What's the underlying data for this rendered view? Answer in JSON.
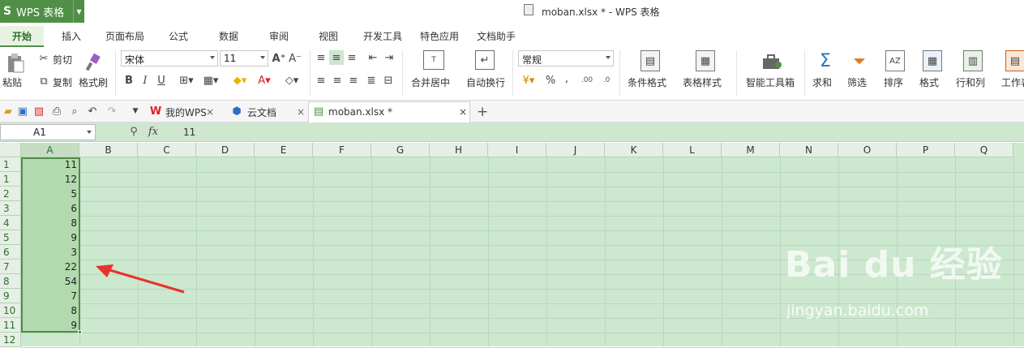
{
  "app": {
    "logo": "S",
    "name": "WPS 表格",
    "title": "moban.xlsx * - WPS 表格"
  },
  "menu": [
    "开始",
    "插入",
    "页面布局",
    "公式",
    "数据",
    "审阅",
    "视图",
    "开发工具",
    "特色应用",
    "文档助手"
  ],
  "ribbon": {
    "paste": "粘贴",
    "cut": "剪切",
    "copy": "复制",
    "format_painter": "格式刷",
    "font_name": "宋体",
    "font_size": "11",
    "merge_center": "合并居中",
    "wrap_text": "自动换行",
    "number_format": "常规",
    "cond_format": "条件格式",
    "table_style": "表格样式",
    "smart_toolbox": "智能工具箱",
    "sum": "求和",
    "filter": "筛选",
    "sort": "排序",
    "format": "格式",
    "rows_cols": "行和列",
    "worksheet": "工作表",
    "percent": "%",
    "comma": ","
  },
  "tabs": {
    "mywps": "我的WPS",
    "cloud": "云文档",
    "file": "moban.xlsx *",
    "close": "×",
    "add": "+"
  },
  "formula": {
    "cell_ref": "A1",
    "fx": "fx",
    "value": "11"
  },
  "columns": [
    "A",
    "B",
    "C",
    "D",
    "E",
    "F",
    "G",
    "H",
    "I",
    "J",
    "K",
    "L",
    "M",
    "N",
    "O",
    "P",
    "Q"
  ],
  "rows": [
    "1",
    "2",
    "3",
    "4",
    "5",
    "6",
    "7",
    "8",
    "9",
    "10",
    "11",
    "12"
  ],
  "row_labels": [
    "1",
    "1",
    "2",
    "3",
    "4",
    "5",
    "6",
    "7",
    "8",
    "9",
    "10",
    "11",
    "12"
  ],
  "cells_A": [
    "11",
    "12",
    "5",
    "6",
    "8",
    "9",
    "3",
    "22",
    "54",
    "7",
    "8",
    "9"
  ],
  "watermark": {
    "brand": "Bai du 经验",
    "url": "jingyan.baidu.com"
  },
  "colors": {
    "accent": "#4f8f46",
    "grid_bg": "#cce8cf",
    "arrow": "#e8332e"
  }
}
